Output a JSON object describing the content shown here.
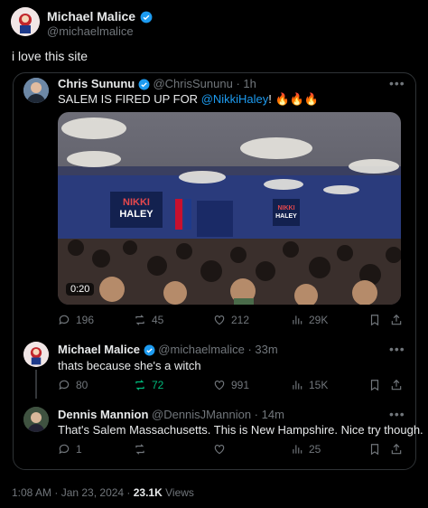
{
  "main_tweet": {
    "author_name": "Michael Malice",
    "author_handle": "@michaelmalice",
    "text": "i love this site",
    "timestamp": "1:08 AM · Jan 23, 2024 · ",
    "views_count": "23.1K",
    "views_label": "Views"
  },
  "quoted_tweet": {
    "author_name": "Chris Sununu",
    "author_handle": "@ChrisSununu",
    "time": "· 1h",
    "text_prefix": "SALEM IS FIRED UP FOR ",
    "text_mention": "@NikkiHaley",
    "text_suffix": "! 🔥🔥🔥",
    "video_duration": "0:20",
    "stage_sign_1": "NIKKI\nHALEY",
    "stage_sign_2": "NIKKI\nHALEY",
    "stats": {
      "replies": "196",
      "reposts": "45",
      "likes": "212",
      "views": "29K"
    }
  },
  "replies": [
    {
      "author_name": "Michael Malice",
      "author_handle": "@michaelmalice",
      "time": "· 33m",
      "text": "thats because she's a witch",
      "stats": {
        "replies": "80",
        "reposts": "72",
        "likes": "991",
        "views": "15K"
      }
    },
    {
      "author_name": "Dennis Mannion",
      "author_handle": "@DennisJMannion",
      "time": "· 14m",
      "text": "That's Salem Massachusetts.  This is New Hampshire.  Nice try though.",
      "stats": {
        "replies": "1",
        "reposts": "",
        "likes": "",
        "views": "25"
      }
    }
  ],
  "colors": {
    "verified_blue": "#1d9bf0",
    "repost_green": "#00ba7c",
    "muted": "#71767b"
  }
}
